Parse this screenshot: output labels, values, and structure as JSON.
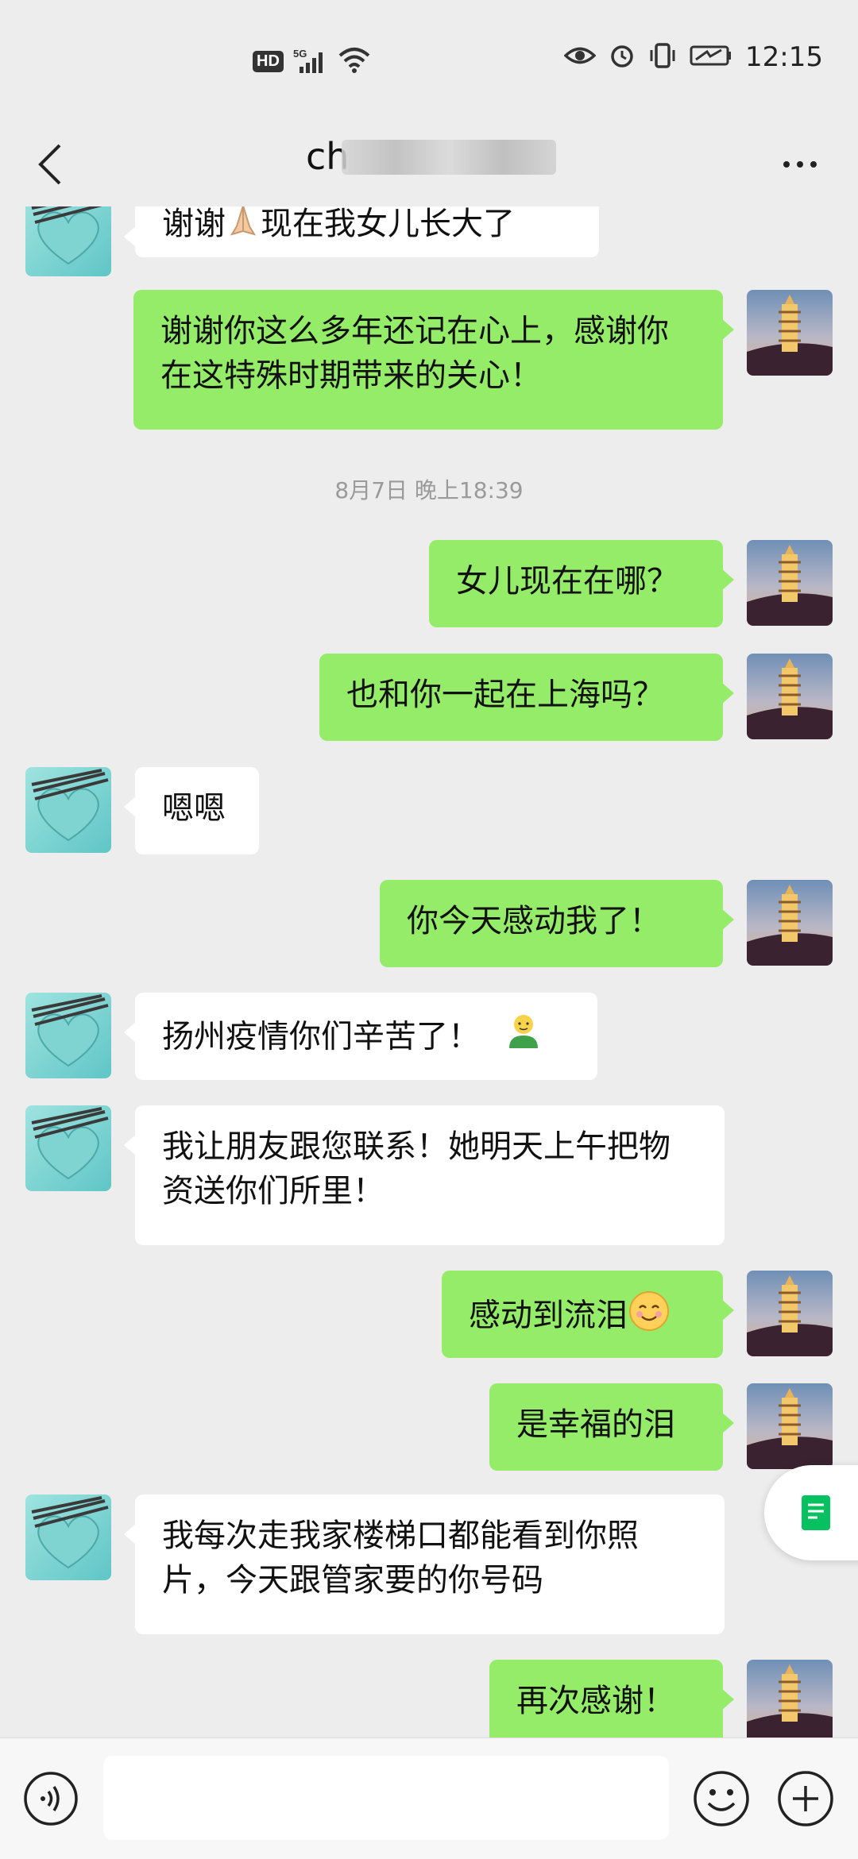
{
  "status_bar": {
    "hd": "HD",
    "network": "5G",
    "time": "12:15"
  },
  "nav": {
    "title_visible": "ch",
    "back_icon": "chevron-left-icon",
    "more_icon": "more-dots-icon"
  },
  "messages": [
    {
      "side": "other",
      "text": "谢谢",
      "emoji": "folded-hands",
      "text2": "现在我女儿长大了"
    },
    {
      "side": "mine",
      "text": "谢谢你这么多年还记在心上，感谢你在这特殊时期带来的关心！"
    },
    {
      "timestamp": "8月7日 晚上18:39"
    },
    {
      "side": "mine",
      "text": "女儿现在在哪？"
    },
    {
      "side": "mine",
      "text": "也和你一起在上海吗？"
    },
    {
      "side": "other",
      "text": "嗯嗯"
    },
    {
      "side": "mine",
      "text": "你今天感动我了！"
    },
    {
      "side": "other",
      "text": "扬州疫情你们辛苦了！",
      "emoji": "green-person"
    },
    {
      "side": "other",
      "text": "我让朋友跟您联系！她明天上午把物资送你们所里！"
    },
    {
      "side": "mine",
      "text": "感动到流泪",
      "emoji": "smiling-face"
    },
    {
      "side": "mine",
      "text": "是幸福的泪"
    },
    {
      "side": "other",
      "text": "我每次走我家楼梯口都能看到你照片，今天跟管家要的你号码"
    },
    {
      "side": "mine",
      "text": "再次感谢！"
    }
  ],
  "input_bar": {
    "placeholder": ""
  },
  "colors": {
    "background": "#ededed",
    "mine_bubble": "#95ec69",
    "other_bubble": "#ffffff"
  }
}
